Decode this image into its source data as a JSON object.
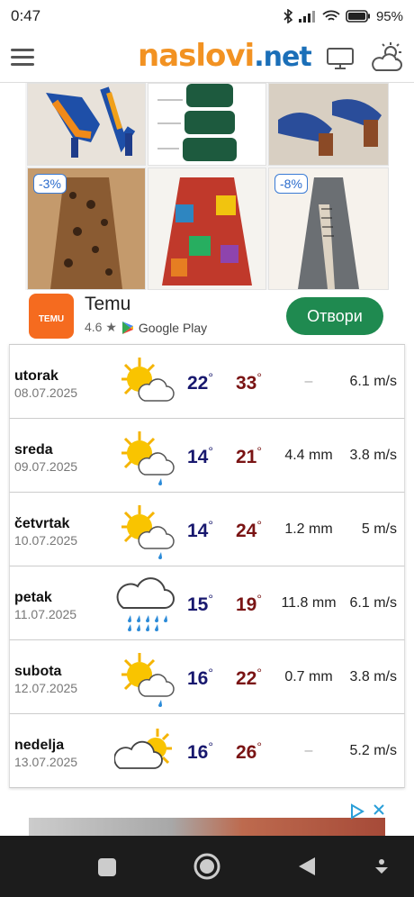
{
  "status": {
    "time": "0:47",
    "battery": "95"
  },
  "header": {
    "logo_part1": "naslovi",
    "logo_part2": ".net"
  },
  "ad": {
    "products": [
      {
        "badge": ""
      },
      {
        "badge": ""
      },
      {
        "badge": ""
      },
      {
        "badge": "-3%"
      },
      {
        "badge": ""
      },
      {
        "badge": "-8%"
      }
    ],
    "app": {
      "name": "Temu",
      "logo_text": "TEMU",
      "rating": "4.6 ★",
      "store": "Google Play",
      "button": "Отвори"
    }
  },
  "forecast": [
    {
      "day": "utorak",
      "date": "08.07.2025",
      "min": "22",
      "max": "33",
      "rain": "–",
      "wind": "6.1 m/s",
      "icon": "sun-cloud-icon"
    },
    {
      "day": "sreda",
      "date": "09.07.2025",
      "min": "14",
      "max": "21",
      "rain": "4.4 mm",
      "wind": "3.8 m/s",
      "icon": "sun-cloud-rain-icon"
    },
    {
      "day": "četvrtak",
      "date": "10.07.2025",
      "min": "14",
      "max": "24",
      "rain": "1.2 mm",
      "wind": "5 m/s",
      "icon": "sun-cloud-rain-icon"
    },
    {
      "day": "petak",
      "date": "11.07.2025",
      "min": "15",
      "max": "19",
      "rain": "11.8 mm",
      "wind": "6.1 m/s",
      "icon": "heavy-rain-icon"
    },
    {
      "day": "subota",
      "date": "12.07.2025",
      "min": "16",
      "max": "22",
      "rain": "0.7 mm",
      "wind": "3.8 m/s",
      "icon": "sun-cloud-rain-icon"
    },
    {
      "day": "nedelja",
      "date": "13.07.2025",
      "min": "16",
      "max": "26",
      "rain": "–",
      "wind": "5.2 m/s",
      "icon": "cloud-sun-icon"
    }
  ],
  "colors": {
    "min_temp": "#18186e",
    "max_temp": "#7a1414",
    "open_button": "#1f8a50",
    "logo_orange": "#f29222",
    "logo_blue": "#1b6fb8"
  }
}
